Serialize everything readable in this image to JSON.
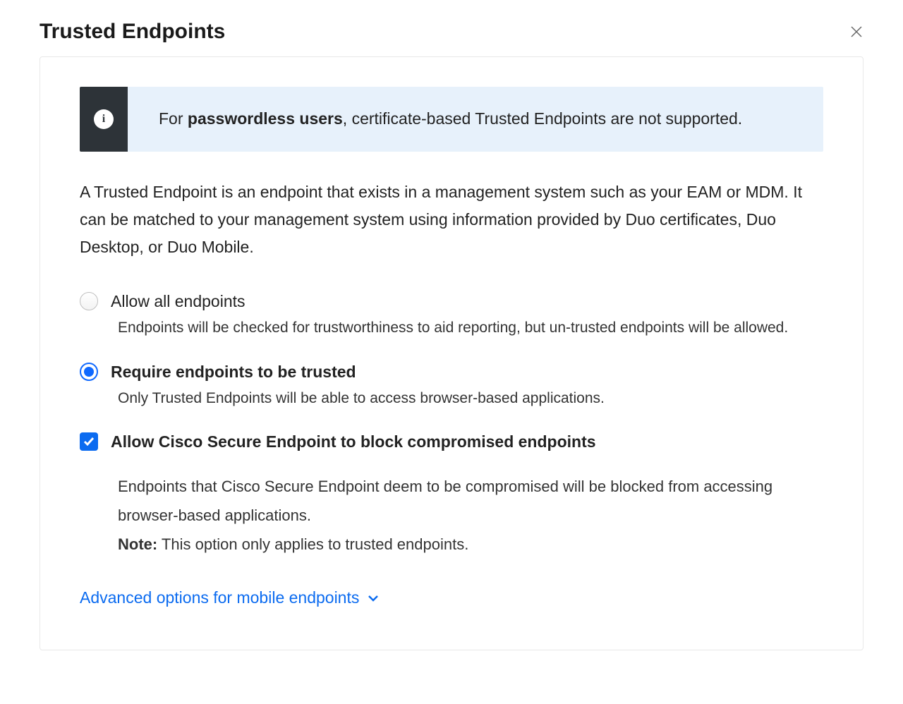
{
  "header": {
    "title": "Trusted Endpoints"
  },
  "banner": {
    "prefix": "For ",
    "bold": "passwordless users",
    "suffix": ", certificate-based Trusted Endpoints are not supported."
  },
  "description": "A Trusted Endpoint is an endpoint that exists in a management system such as your EAM or MDM. It can be matched to your management system using information provided by Duo certificates, Duo Desktop, or Duo Mobile.",
  "options": {
    "allow_all": {
      "label": "Allow all endpoints",
      "desc": "Endpoints will be checked for trustworthiness to aid reporting, but un-trusted endpoints will be allowed.",
      "selected": false
    },
    "require_trusted": {
      "label": "Require endpoints to be trusted",
      "desc": "Only Trusted Endpoints will be able to access browser-based applications.",
      "selected": true
    },
    "block_compromised": {
      "label": "Allow Cisco Secure Endpoint to block compromised endpoints",
      "desc": "Endpoints that Cisco Secure Endpoint deem to be compromised will be blocked from accessing browser-based applications.",
      "note_label": "Note:",
      "note_text": " This option only applies to trusted endpoints.",
      "checked": true
    }
  },
  "advanced_link": "Advanced options for mobile endpoints"
}
